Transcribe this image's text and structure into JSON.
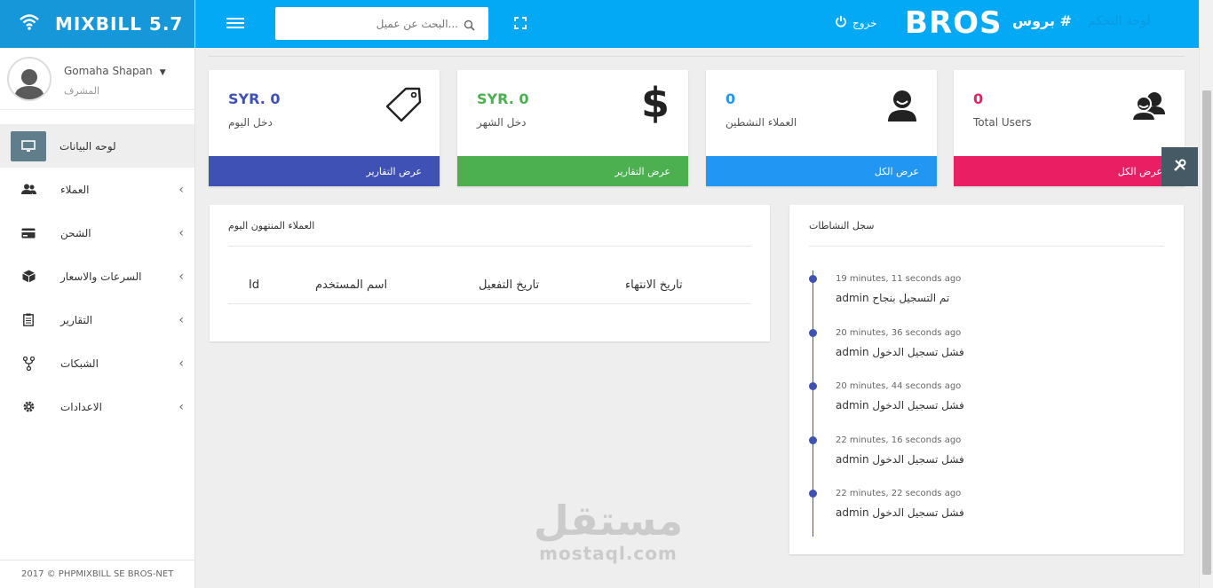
{
  "brand": {
    "title": "MIXBILL 5.7"
  },
  "user": {
    "name": "Gomaha Shapan",
    "role": "المشرف"
  },
  "sidebar": {
    "items": [
      {
        "label": "لوحه البيانات"
      },
      {
        "label": "العملاء"
      },
      {
        "label": "الشحن"
      },
      {
        "label": "السرعات والاسعار"
      },
      {
        "label": "التقارير"
      },
      {
        "label": "الشبكات"
      },
      {
        "label": "الاعدادات"
      }
    ],
    "footer": "2017 © PHPMIXBILL SE BROS-NET"
  },
  "topbar": {
    "search_placeholder": "...البحث عن عميل",
    "logout": "خروج",
    "bros": "BROS",
    "tagline": "# بروس",
    "tagline_ghost": "لوحة التحكم"
  },
  "cards": [
    {
      "value": "SYR. 0",
      "label": "دخل اليوم",
      "footer": "عرض التقارير",
      "color": "#3f51b5"
    },
    {
      "value": "SYR. 0",
      "label": "دخل الشهر",
      "footer": "عرض التقارير",
      "color": "#4caf50"
    },
    {
      "value": "0",
      "label": "العملاء النشطين",
      "footer": "عرض الكل",
      "color": "#2196f3"
    },
    {
      "value": "0",
      "label": "Total Users",
      "footer": "عرض الكل",
      "color": "#e91e63"
    }
  ],
  "expired_panel": {
    "title": "العملاء المنتهون اليوم",
    "columns": {
      "id": "Id",
      "username": "اسم المستخدم",
      "activation": "تاريخ التفعيل",
      "expiry": "تاريخ الانتهاء"
    }
  },
  "activity_panel": {
    "title": "سجل النشاطات",
    "items": [
      {
        "time": "19 minutes, 11 seconds ago",
        "msg": "admin تم التسجيل بنجاح"
      },
      {
        "time": "20 minutes, 36 seconds ago",
        "msg": "admin فشل تسجيل الدخول"
      },
      {
        "time": "20 minutes, 44 seconds ago",
        "msg": "admin فشل تسجيل الدخول"
      },
      {
        "time": "22 minutes, 16 seconds ago",
        "msg": "admin فشل تسجيل الدخول"
      },
      {
        "time": "22 minutes, 22 seconds ago",
        "msg": "admin فشل تسجيل الدخول"
      }
    ]
  },
  "watermark": {
    "arabic": "مستقل",
    "latin": "mostaql.com"
  },
  "icons": {
    "wifi": "wifi-icon",
    "menu": "hamburger-icon",
    "search": "search-icon",
    "fullscreen": "fullscreen-icon",
    "power": "power-icon",
    "tag": "tag-icon",
    "dollar": "dollar-icon",
    "user": "user-icon",
    "users": "users-icon",
    "tools": "tools-icon"
  }
}
